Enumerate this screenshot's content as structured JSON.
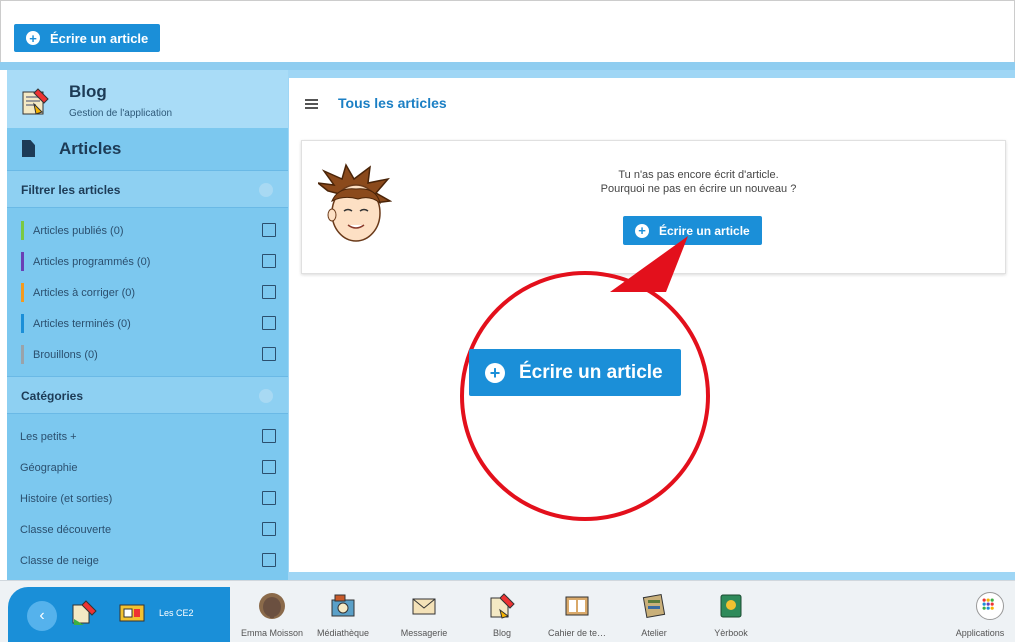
{
  "toolbar": {
    "write_label": "Écrire un article"
  },
  "app": {
    "title": "Blog",
    "subtitle": "Gestion de l'application"
  },
  "sidebar": {
    "section_title": "Articles",
    "filter_title": "Filtrer les articles",
    "filters": [
      {
        "label": "Articles publiés (0)",
        "color": "#7ac943"
      },
      {
        "label": "Articles programmés (0)",
        "color": "#6a3fb5"
      },
      {
        "label": "Articles à corriger (0)",
        "color": "#f39a1e"
      },
      {
        "label": "Articles terminés (0)",
        "color": "#1b8fd8"
      },
      {
        "label": "Brouillons (0)",
        "color": "#9aa3aa"
      }
    ],
    "categories_title": "Catégories",
    "categories": [
      {
        "label": "Les petits +"
      },
      {
        "label": "Géographie"
      },
      {
        "label": "Histoire (et sorties)"
      },
      {
        "label": "Classe découverte"
      },
      {
        "label": "Classe de neige"
      }
    ]
  },
  "main": {
    "breadcrumb": "Tous les articles",
    "empty_line1": "Tu n'as pas encore écrit d'article.",
    "empty_line2": "Pourquoi ne pas en écrire un nouveau ?",
    "write_label": "Écrire un article"
  },
  "callout": {
    "write_label": "Écrire un article"
  },
  "dock": {
    "class_label": "Les CE2",
    "items": [
      {
        "label": "Emma Moisson",
        "icon": "avatar-elephant-icon"
      },
      {
        "label": "Médiathèque",
        "icon": "media-icon"
      },
      {
        "label": "Messagerie",
        "icon": "envelope-icon"
      },
      {
        "label": "Blog",
        "icon": "blog-icon"
      },
      {
        "label": "Cahier de te…",
        "icon": "notebook-icon"
      },
      {
        "label": "Atelier",
        "icon": "workshop-icon"
      },
      {
        "label": "Yèrbook",
        "icon": "yearbook-icon"
      }
    ],
    "apps_label": "Applications"
  },
  "colors": {
    "accent": "#1b8fd8",
    "sidebar": "#7cc8ef",
    "callout_red": "#e3101c"
  }
}
